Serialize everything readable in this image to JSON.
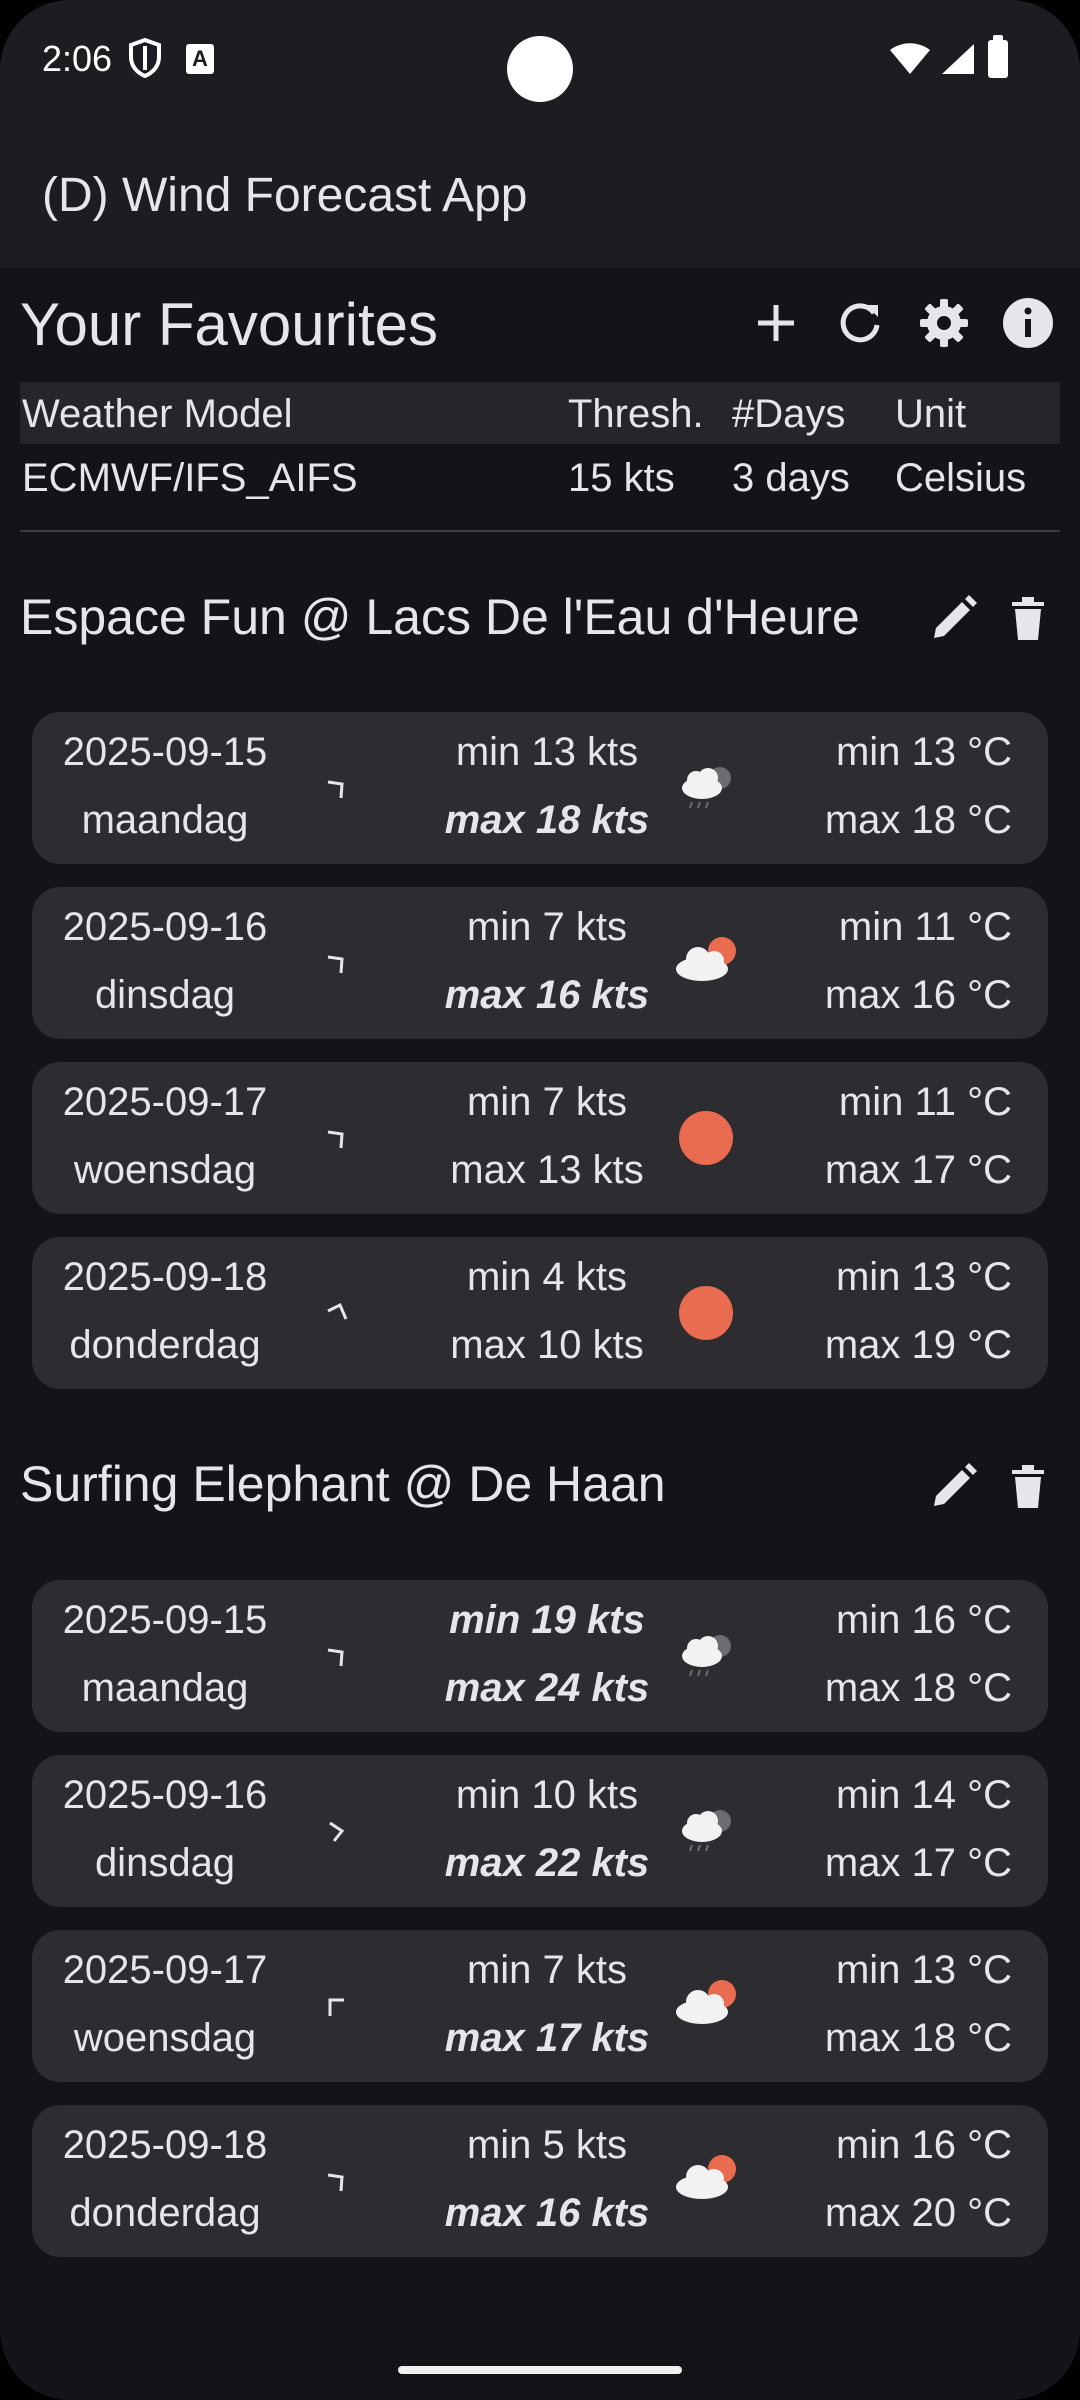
{
  "status_bar": {
    "time": "2:06",
    "a_icon_label": "A"
  },
  "app": {
    "title": "(D) Wind Forecast App"
  },
  "favourites": {
    "title": "Your Favourites",
    "actions": [
      "plus-icon",
      "refresh-icon",
      "gear-icon",
      "info-icon"
    ]
  },
  "settings": {
    "headers": [
      "Weather Model",
      "Thresh.",
      "#Days",
      "Unit"
    ],
    "values": [
      "ECMWF/IFS_AIFS",
      "15 kts",
      "3 days",
      "Celsius"
    ]
  },
  "locations": [
    {
      "name": "Espace Fun @ Lacs De l'Eau d'Heure",
      "forecasts": [
        {
          "date": "2025-09-15",
          "day": "maandag",
          "wind_min": "min 13 kts",
          "wind_max": "max 18 kts",
          "temp_min": "min 13 °C",
          "temp_max": "max 18 °C",
          "icon": "rain-cloud-icon"
        },
        {
          "date": "2025-09-16",
          "day": "dinsdag",
          "wind_min": "min 7 kts",
          "wind_max": "max 16 kts",
          "temp_min": "min 11 °C",
          "temp_max": "max 16 °C",
          "icon": "partly-cloudy-icon"
        },
        {
          "date": "2025-09-17",
          "day": "woensdag",
          "wind_min": "min 7 kts",
          "wind_max": "max 13 kts",
          "temp_min": "min 11 °C",
          "temp_max": "max 17 °C",
          "icon": "sun-icon"
        },
        {
          "date": "2025-09-18",
          "day": "donderdag",
          "wind_min": "min 4 kts",
          "wind_max": "max 10 kts",
          "temp_min": "min 13 °C",
          "temp_max": "max 19 °C",
          "icon": "sun-icon"
        }
      ]
    },
    {
      "name": "Surfing Elephant @ De Haan",
      "forecasts": [
        {
          "date": "2025-09-15",
          "day": "maandag",
          "wind_min": "min 19 kts",
          "wind_max": "max 24 kts",
          "temp_min": "min 16 °C",
          "temp_max": "max 18 °C",
          "icon": "rain-cloud-icon"
        },
        {
          "date": "2025-09-16",
          "day": "dinsdag",
          "wind_min": "min 10 kts",
          "wind_max": "max 22 kts",
          "temp_min": "min 14 °C",
          "temp_max": "max 17 °C",
          "icon": "rain-cloud-icon"
        },
        {
          "date": "2025-09-17",
          "day": "woensdag",
          "wind_min": "min 7 kts",
          "wind_max": "max 17 kts",
          "temp_min": "min 13 °C",
          "temp_max": "max 18 °C",
          "icon": "partly-cloudy-icon"
        },
        {
          "date": "2025-09-18",
          "day": "donderdag",
          "wind_min": "min 5 kts",
          "wind_max": "max 16 kts",
          "temp_min": "min 16 °C",
          "temp_max": "max 20 °C",
          "icon": "partly-cloudy-icon"
        }
      ]
    }
  ],
  "colors": {
    "accent_sun": "#e96c50",
    "card_bg": "#2c2c31",
    "background": "#131318"
  }
}
